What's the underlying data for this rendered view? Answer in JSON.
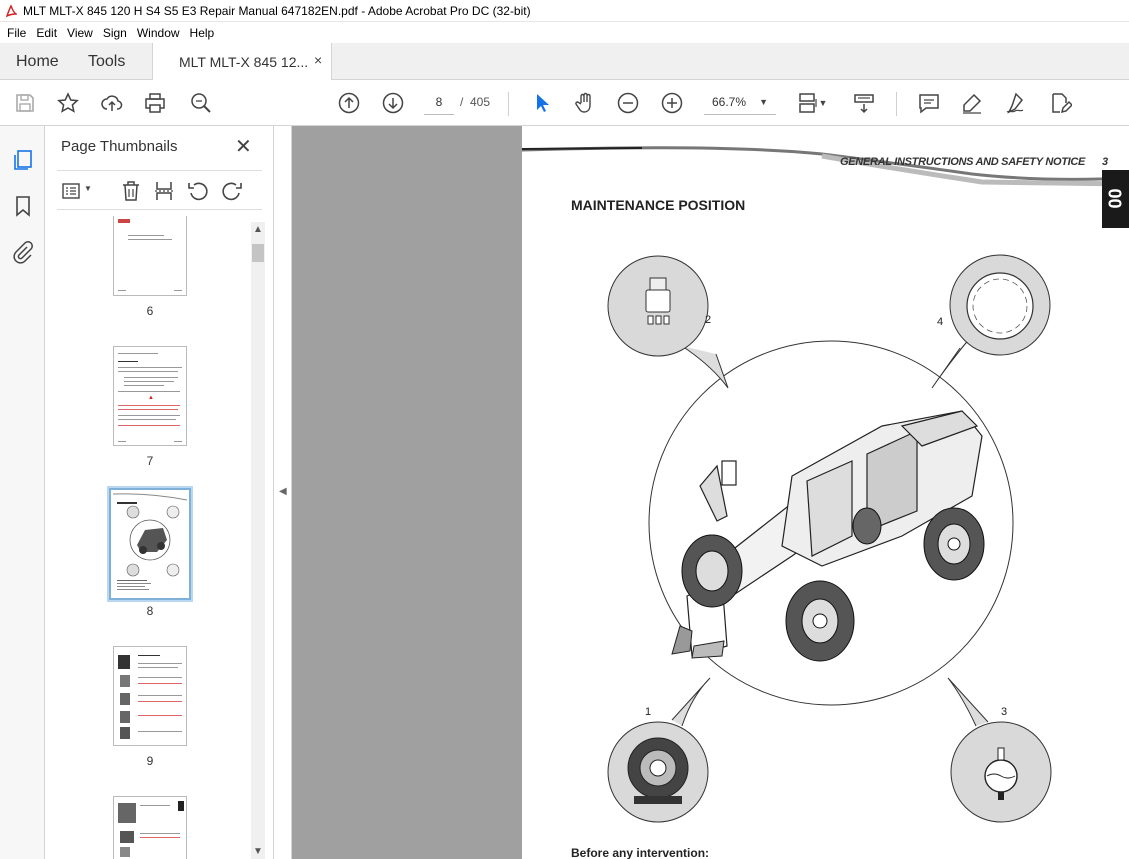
{
  "window": {
    "title": "MLT MLT-X 845 120 H S4 S5 E3 Repair Manual 647182EN.pdf - Adobe Acrobat Pro DC (32-bit)",
    "app_icon": "acrobat-icon"
  },
  "menu": {
    "items": [
      "File",
      "Edit",
      "View",
      "Sign",
      "Window",
      "Help"
    ]
  },
  "tabs": {
    "home": "Home",
    "tools": "Tools",
    "document": "MLT MLT-X 845 12...",
    "close": "×"
  },
  "toolbar": {
    "icons": [
      "save-icon",
      "star-icon",
      "upload-icon",
      "print-icon",
      "zoom-search-icon",
      "page-up-icon",
      "page-down-icon",
      "select-cursor-icon",
      "hand-icon",
      "zoom-out-icon",
      "zoom-in-icon",
      "fit-page-icon",
      "scroll-mode-icon",
      "comment-icon",
      "highlight-icon",
      "sign-icon",
      "edit-icon"
    ],
    "current_page": "8",
    "page_separator": "/",
    "total_pages": "405",
    "zoom": "66.7%"
  },
  "rail": {
    "icons": [
      "page-thumbnails-icon",
      "bookmark-icon",
      "attachment-icon"
    ]
  },
  "thumbnails": {
    "title": "Page Thumbnails",
    "close": "✕",
    "pages": [
      {
        "number": "6"
      },
      {
        "number": "7"
      },
      {
        "number": "8",
        "selected": true
      },
      {
        "number": "9"
      }
    ]
  },
  "document": {
    "header": "GENERAL INSTRUCTIONS AND SAFETY NOTICE",
    "page_number": "3",
    "section_tab": "00",
    "heading": "MAINTENANCE POSITION",
    "callouts": [
      "1",
      "2",
      "3",
      "4"
    ],
    "footer": "Before any intervention:"
  }
}
